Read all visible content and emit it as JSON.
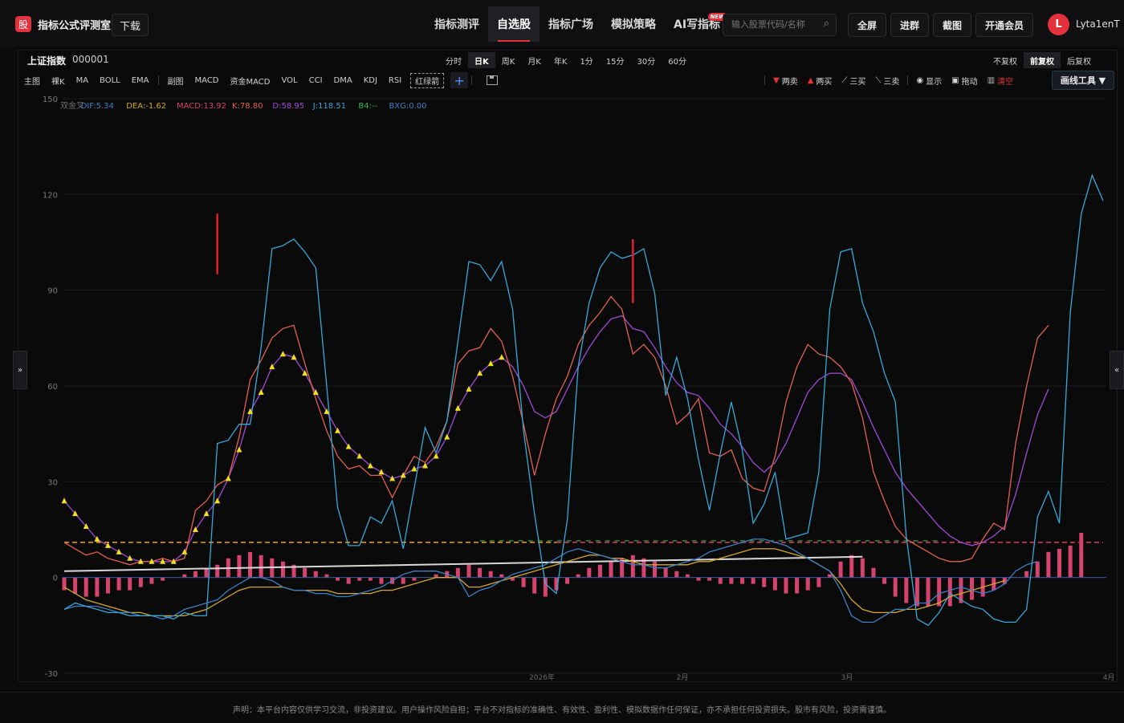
{
  "app": {
    "logo_char": "股",
    "title": "指标公式评测室",
    "download": "下载"
  },
  "nav": [
    {
      "label": "指标测评"
    },
    {
      "label": "自选股",
      "active": true
    },
    {
      "label": "指标广场"
    },
    {
      "label": "模拟策略"
    },
    {
      "label": "AI写指标",
      "badge": "NEW"
    }
  ],
  "search": {
    "placeholder": "输入股票代码/名称"
  },
  "top_buttons": [
    "全屏",
    "进群",
    "截图",
    "开通会员"
  ],
  "user": {
    "avatar_initial": "L",
    "name": "Lyta1enT"
  },
  "stock": {
    "name": "上证指数",
    "code": "000001"
  },
  "periods": [
    "分时",
    "日K",
    "周K",
    "月K",
    "年K",
    "1分",
    "15分",
    "30分",
    "60分"
  ],
  "active_period": "日K",
  "adjust": [
    "不复权",
    "前复权",
    "后复权"
  ],
  "active_adjust": "前复权",
  "indicator_tabs": [
    "主图",
    "裸K",
    "MA",
    "BOLL",
    "EMA",
    "副图",
    "MACD",
    "资金MACD",
    "VOL",
    "CCI",
    "DMA",
    "KDJ",
    "RSI",
    "红绿箭"
  ],
  "tools": [
    {
      "label": "两卖",
      "icon": "triangle-down-icon",
      "color": "#e3323b"
    },
    {
      "label": "两买",
      "icon": "triangle-up-icon",
      "color": "#e3323b"
    },
    {
      "label": "三买",
      "icon": "chart-line-icon",
      "color": "#d0d0d0"
    },
    {
      "label": "三卖",
      "icon": "chart-line-icon",
      "color": "#d0d0d0"
    },
    {
      "label": "显示",
      "icon": "eye-icon",
      "color": "#d0d0d0"
    },
    {
      "label": "拖动",
      "icon": "lock-icon",
      "color": "#d0d0d0"
    },
    {
      "label": "清空",
      "icon": "trash-icon",
      "color": "#e3323b"
    }
  ],
  "draw_tools": "画线工具 ▼",
  "legend": [
    {
      "label": "双金叉",
      "color": "#6d6d6d"
    },
    {
      "label": "DIF:5.34",
      "color": "#3d7fc4"
    },
    {
      "label": "DEA:-1.62",
      "color": "#d4a72c"
    },
    {
      "label": "MACD:13.92",
      "color": "#d6436e"
    },
    {
      "label": "K:78.80",
      "color": "#e0624f"
    },
    {
      "label": "D:58.95",
      "color": "#a04ad6"
    },
    {
      "label": "J:118.51",
      "color": "#38a8d8"
    },
    {
      "label": "B4:--",
      "color": "#2eb84a"
    },
    {
      "label": "BXG:0.00",
      "color": "#3d7fc4"
    }
  ],
  "chart_data": {
    "type": "line",
    "ylim": [
      -30,
      150
    ],
    "yticks": [
      150,
      120,
      90,
      60,
      30,
      0,
      -30
    ],
    "xtick_labels": [
      "2026年",
      "2月",
      "3月",
      "4月"
    ],
    "series": [
      {
        "name": "J",
        "color": "#38a8d8",
        "values": [
          -10,
          -8,
          -9,
          -10,
          -11,
          -11,
          -12,
          -12,
          -12,
          -12,
          -13,
          -11,
          -12,
          -12,
          42,
          43,
          48,
          48,
          72,
          103,
          104,
          106,
          102,
          97,
          60,
          22,
          10,
          10,
          19,
          17,
          24,
          9,
          28,
          47,
          39,
          49,
          74,
          99,
          98,
          93,
          99,
          84,
          46,
          20,
          -2,
          -5,
          18,
          66,
          86,
          97,
          102,
          100,
          101,
          103,
          89,
          57,
          69,
          56,
          37,
          21,
          39,
          55,
          40,
          17,
          23,
          33,
          12,
          13,
          14,
          33,
          84,
          102,
          103,
          86,
          77,
          64,
          55,
          13,
          -13,
          -15,
          -11,
          -5,
          -7,
          -9,
          -10,
          -13,
          -14,
          -14,
          -10,
          19,
          27,
          17,
          83,
          114,
          126,
          118
        ]
      },
      {
        "name": "K",
        "color": "#e0624f",
        "values": [
          11,
          9,
          7,
          8,
          6,
          5,
          4,
          5,
          5,
          6,
          5,
          6,
          21,
          24,
          29,
          31,
          44,
          62,
          68,
          75,
          78,
          79,
          67,
          56,
          46,
          38,
          34,
          35,
          32,
          32,
          25,
          32,
          38,
          36,
          41,
          49,
          67,
          71,
          72,
          78,
          74,
          63,
          48,
          32,
          45,
          56,
          63,
          73,
          79,
          83,
          88,
          84,
          70,
          73,
          69,
          60,
          48,
          51,
          56,
          39,
          38,
          40,
          31,
          28,
          27,
          38,
          55,
          66,
          73,
          70,
          69,
          66,
          61,
          50,
          33,
          24,
          16,
          12,
          10,
          8,
          6,
          5,
          5,
          6,
          12,
          17,
          15,
          42,
          60,
          75,
          79
        ]
      },
      {
        "name": "D",
        "color": "#a04ad6",
        "values": [
          24,
          20,
          16,
          12,
          10,
          8,
          6,
          5,
          5,
          5,
          5,
          8,
          15,
          20,
          24,
          31,
          40,
          52,
          58,
          66,
          70,
          69,
          64,
          58,
          52,
          46,
          41,
          38,
          35,
          33,
          31,
          32,
          34,
          35,
          38,
          44,
          53,
          59,
          64,
          67,
          69,
          66,
          60,
          52,
          50,
          52,
          59,
          66,
          72,
          77,
          81,
          82,
          78,
          77,
          72,
          66,
          61,
          58,
          57,
          53,
          48,
          45,
          41,
          36,
          33,
          36,
          42,
          50,
          58,
          62,
          64,
          64,
          62,
          55,
          47,
          40,
          33,
          28,
          24,
          20,
          16,
          13,
          11,
          10,
          11,
          13,
          16,
          26,
          39,
          51,
          59
        ]
      },
      {
        "name": "DIF",
        "color": "#3d7fc4",
        "values": [
          -10,
          -9,
          -9,
          -9,
          -10,
          -11,
          -11,
          -12,
          -12,
          -13,
          -12,
          -10,
          -9,
          -8,
          -7,
          -4,
          -2,
          0,
          0,
          -1,
          -3,
          -4,
          -4,
          -5,
          -5,
          -6,
          -6,
          -5,
          -4,
          -3,
          -1,
          1,
          2,
          2,
          2,
          1,
          0,
          -6,
          -4,
          -3,
          -1,
          1,
          2,
          3,
          4,
          6,
          8,
          9,
          8,
          7,
          6,
          5,
          4,
          4,
          3,
          3,
          4,
          5,
          6,
          8,
          9,
          10,
          11,
          12,
          12,
          11,
          10,
          8,
          6,
          4,
          2,
          -4,
          -12,
          -14,
          -14,
          -12,
          -10,
          -10,
          -8,
          -8,
          -5,
          -4,
          -3,
          -4,
          -5,
          -4,
          -2,
          2,
          4,
          5
        ]
      },
      {
        "name": "DEA",
        "color": "#d4a72c",
        "values": [
          -3,
          -5,
          -7,
          -8,
          -9,
          -10,
          -11,
          -11,
          -12,
          -12,
          -12,
          -12,
          -11,
          -10,
          -8,
          -6,
          -4,
          -3,
          -3,
          -3,
          -3,
          -4,
          -4,
          -4,
          -4,
          -5,
          -5,
          -5,
          -5,
          -4,
          -4,
          -3,
          -2,
          -1,
          0,
          0,
          0,
          -3,
          -3,
          -2,
          -1,
          0,
          1,
          2,
          3,
          4,
          5,
          6,
          7,
          7,
          6,
          6,
          5,
          4,
          4,
          4,
          4,
          4,
          5,
          5,
          6,
          7,
          8,
          9,
          9,
          9,
          8,
          7,
          6,
          4,
          2,
          -2,
          -7,
          -10,
          -11,
          -11,
          -11,
          -10,
          -10,
          -9,
          -8,
          -6,
          -5,
          -4,
          -3,
          -2,
          -1
        ]
      },
      {
        "name": "MACD",
        "color": "#d6436e",
        "values": [
          -4,
          -5,
          -6,
          -6,
          -5,
          -4,
          -4,
          -3,
          -2,
          -1,
          0,
          1,
          2,
          3,
          4,
          6,
          7,
          8,
          7,
          6,
          5,
          4,
          3,
          2,
          1,
          -1,
          -2,
          -1,
          -1,
          -2,
          -2,
          -2,
          -1,
          0,
          1,
          2,
          3,
          4,
          3,
          2,
          1,
          -1,
          -3,
          -5,
          -6,
          -4,
          -2,
          1,
          3,
          4,
          5,
          6,
          7,
          6,
          5,
          3,
          2,
          1,
          -1,
          -1,
          -2,
          -2,
          -2,
          -2,
          -3,
          -4,
          -5,
          -5,
          -4,
          -3,
          1,
          5,
          7,
          6,
          3,
          -2,
          -6,
          -8,
          -9,
          -9,
          -9,
          -9,
          -8,
          -7,
          -6,
          -4,
          -2,
          0,
          2,
          5,
          8,
          9,
          10,
          14
        ]
      }
    ],
    "dashed_level": 11,
    "trend_line": {
      "from": [
        0,
        2
      ],
      "to": [
        73,
        6.5
      ]
    },
    "vertical_signals": [
      {
        "x": 14,
        "ylow": 95,
        "yhigh": 114
      },
      {
        "x": 52,
        "ylow": 86,
        "yhigh": 106
      }
    ]
  },
  "footer": "声明：本平台内容仅供学习交流，非投资建议。用户操作风险自担；平台不对指标的准确性、有效性、盈利性、模拟数据作任何保证，亦不承担任何投资损失。股市有风险，投资需谨慎。"
}
